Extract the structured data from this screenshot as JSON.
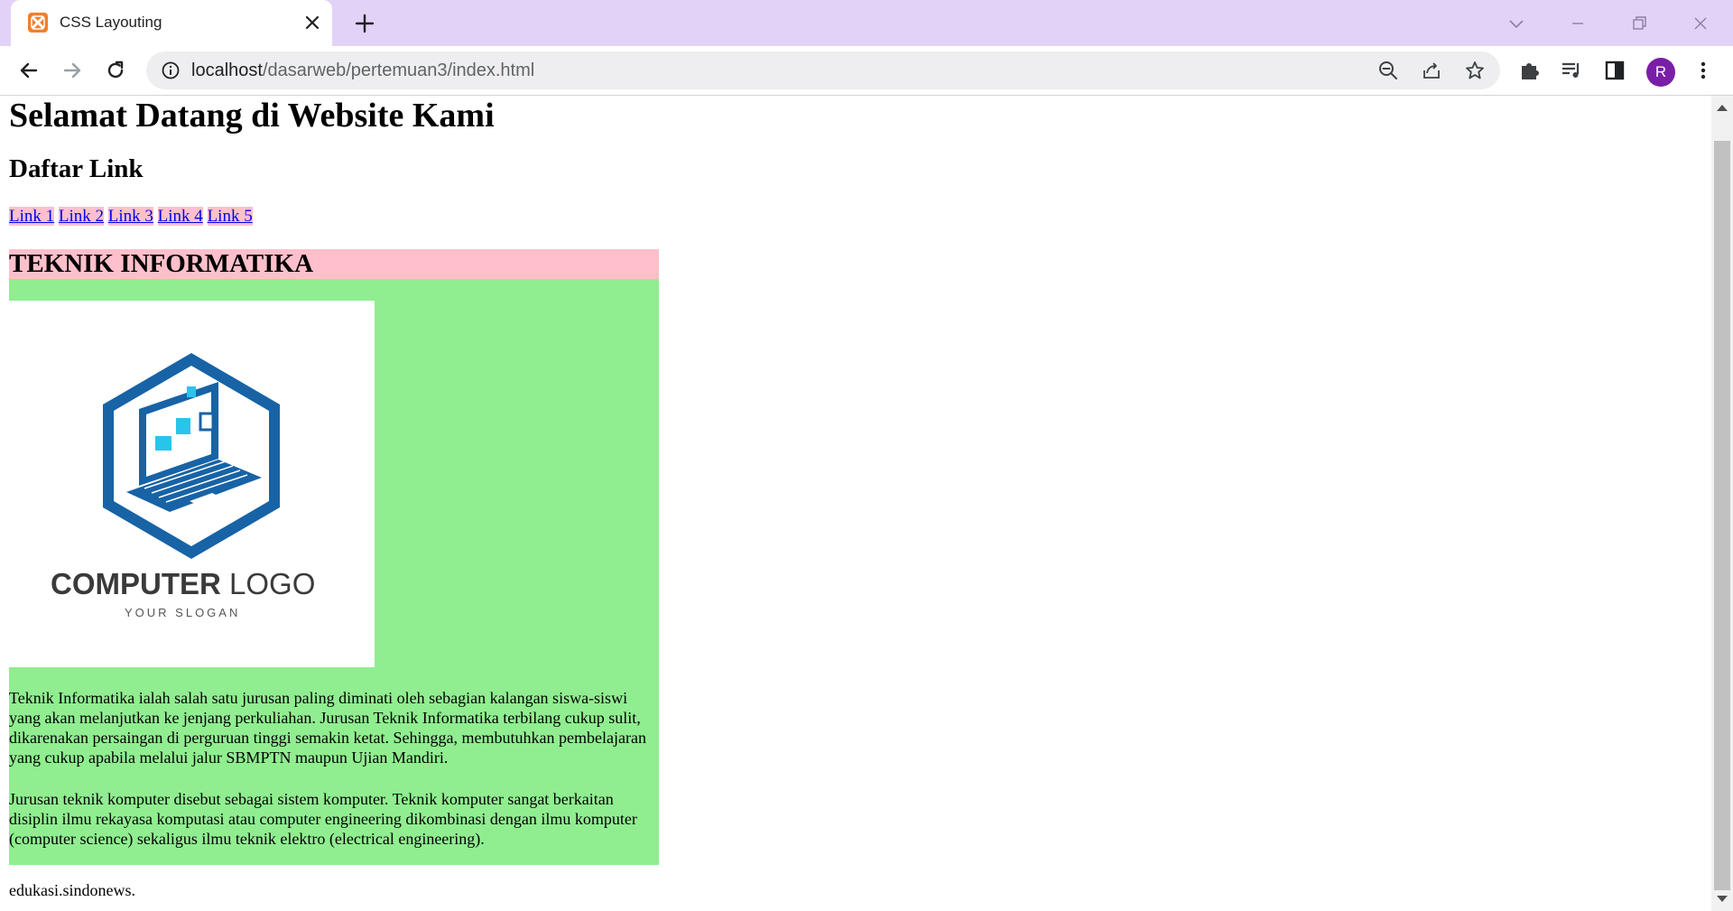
{
  "browser": {
    "tab_title": "CSS Layouting",
    "url_host": "localhost",
    "url_path": "/dasarweb/pertemuan3/index.html",
    "avatar_letter": "R",
    "accent_color": "#e3d2f7",
    "avatar_color": "#7a1ea8"
  },
  "page": {
    "heading": "Selamat Datang di Website Kami",
    "subheading": "Daftar Link",
    "links": [
      "Link 1",
      "Link 2",
      "Link 3",
      "Link 4",
      "Link 5"
    ],
    "section_title": "TEKNIK INFORMATIKA",
    "logo": {
      "brand_bold": "COMPUTER",
      "brand_light": "LOGO",
      "slogan": "YOUR SLOGAN"
    },
    "paragraph_1": "Teknik Informatika ialah salah satu jurusan paling diminati oleh sebagian kalangan siswa-siswi yang akan melanjutkan ke jenjang perkuliahan. Jurusan Teknik Informatika terbilang cukup sulit, dikarenakan persaingan di perguruan tinggi semakin ketat. Sehingga, membutuhkan pembelajaran yang cukup apabila melalui jalur SBMPTN maupun Ujian Mandiri.",
    "paragraph_2": "Jurusan teknik komputer disebut sebagai sistem komputer. Teknik komputer sangat berkaitan disiplin ilmu rekayasa komputasi atau computer engineering dikombinasi dengan ilmu komputer (computer science) sekaligus ilmu teknik elektro (electrical engineering).",
    "footer": "edukasi.sindonews.",
    "colors": {
      "link_bg": "#ffc0cb",
      "header_bg": "#ffc0cb",
      "content_bg": "#90ee90"
    }
  }
}
